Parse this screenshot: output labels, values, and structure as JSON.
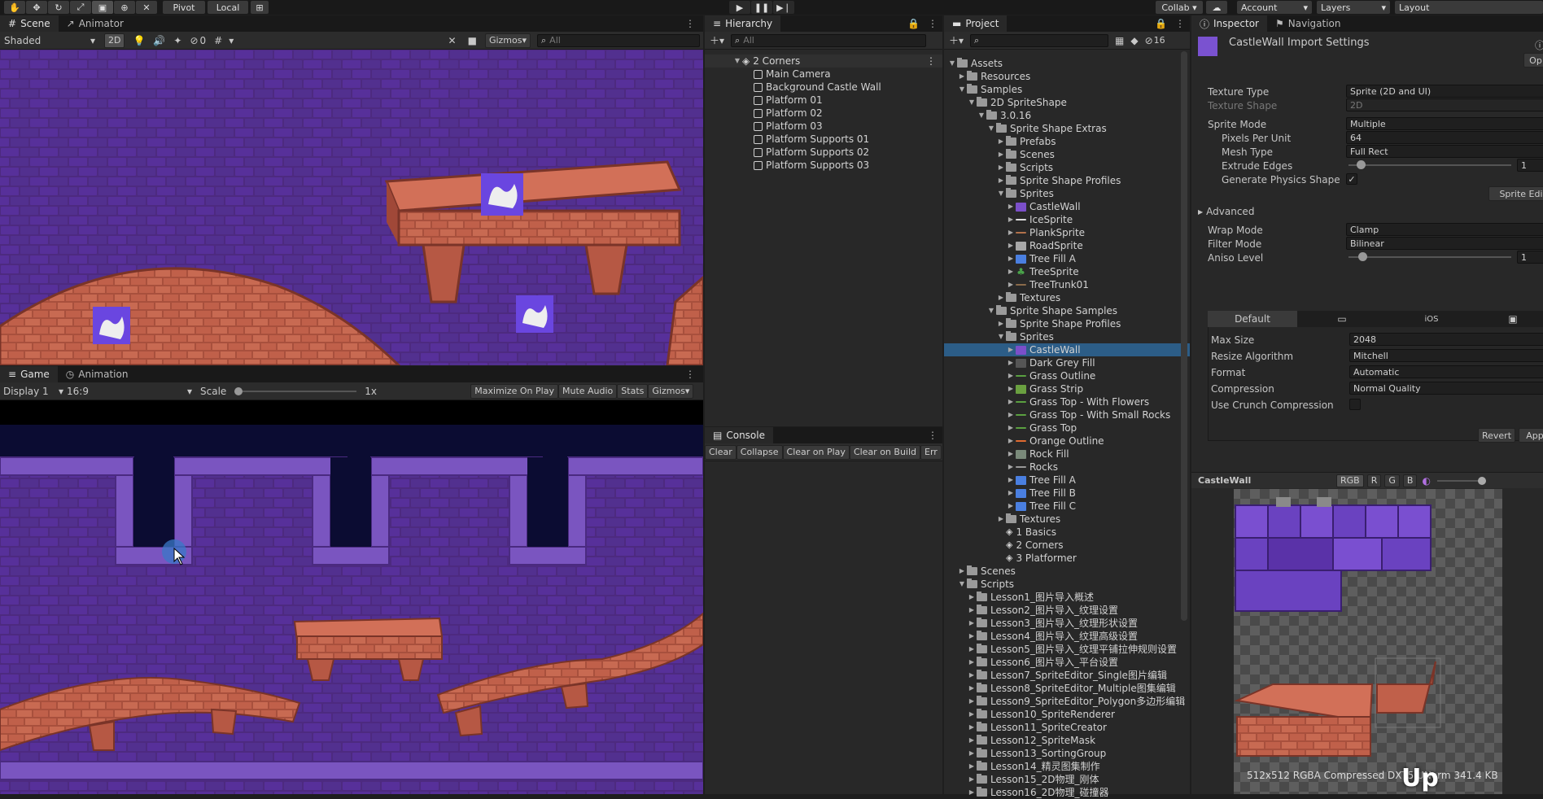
{
  "toolbar": {
    "pivot": "Pivot",
    "local": "Local",
    "collab": "Collab ▾",
    "account": "Account",
    "layers": "Layers",
    "layout": "Layout"
  },
  "scene": {
    "tab_scene": "Scene",
    "tab_animator": "Animator",
    "shading": "Shaded",
    "mode_2d": "2D",
    "gizmos": "Gizmos",
    "search_placeholder": "All",
    "fx_count": "0"
  },
  "game": {
    "tab_game": "Game",
    "tab_animation": "Animation",
    "display": "Display 1",
    "aspect": "16:9",
    "scale_label": "Scale",
    "scale_value": "1x",
    "maximize": "Maximize On Play",
    "mute": "Mute Audio",
    "stats": "Stats",
    "gizmos": "Gizmos"
  },
  "hierarchy": {
    "title": "Hierarchy",
    "search_placeholder": "All",
    "root": "2 Corners",
    "items": [
      "Main Camera",
      "Background Castle Wall",
      "Platform 01",
      "Platform 02",
      "Platform 03",
      "Platform Supports 01",
      "Platform Supports 02",
      "Platform Supports 03"
    ]
  },
  "console": {
    "title": "Console",
    "buttons": [
      "Clear",
      "Collapse",
      "Clear on Play",
      "Clear on Build",
      "Err"
    ]
  },
  "project": {
    "title": "Project",
    "hidden_count": "16",
    "rows": [
      {
        "label": "Assets",
        "indent": 0,
        "type": "folder",
        "open": true
      },
      {
        "label": "Resources",
        "indent": 1,
        "type": "folder",
        "open": false
      },
      {
        "label": "Samples",
        "indent": 1,
        "type": "folder",
        "open": true
      },
      {
        "label": "2D SpriteShape",
        "indent": 2,
        "type": "folder",
        "open": true
      },
      {
        "label": "3.0.16",
        "indent": 3,
        "type": "folder",
        "open": true
      },
      {
        "label": "Sprite Shape Extras",
        "indent": 4,
        "type": "folder",
        "open": true
      },
      {
        "label": "Prefabs",
        "indent": 5,
        "type": "folder",
        "open": false
      },
      {
        "label": "Scenes",
        "indent": 5,
        "type": "folder",
        "open": false
      },
      {
        "label": "Scripts",
        "indent": 5,
        "type": "folder",
        "open": false
      },
      {
        "label": "Sprite Shape Profiles",
        "indent": 5,
        "type": "folder",
        "open": false
      },
      {
        "label": "Sprites",
        "indent": 5,
        "type": "folder",
        "open": true
      },
      {
        "label": "CastleWall",
        "indent": 6,
        "type": "sprite",
        "color": "#7b4fc9",
        "open": false
      },
      {
        "label": "IceSprite",
        "indent": 6,
        "type": "line",
        "color": "#dddddd",
        "open": false
      },
      {
        "label": "PlankSprite",
        "indent": 6,
        "type": "line",
        "color": "#b3724a",
        "open": false
      },
      {
        "label": "RoadSprite",
        "indent": 6,
        "type": "sprite",
        "color": "#a8a8a8",
        "open": false
      },
      {
        "label": "Tree Fill A",
        "indent": 6,
        "type": "sprite",
        "color": "#4a7fe0",
        "open": false
      },
      {
        "label": "TreeSprite",
        "indent": 6,
        "type": "tree",
        "color": "#4aa34a",
        "open": false
      },
      {
        "label": "TreeTrunk01",
        "indent": 6,
        "type": "line",
        "color": "#8a6a4a",
        "open": false
      },
      {
        "label": "Textures",
        "indent": 5,
        "type": "folder",
        "open": false
      },
      {
        "label": "Sprite Shape Samples",
        "indent": 4,
        "type": "folder",
        "open": true
      },
      {
        "label": "Sprite Shape Profiles",
        "indent": 5,
        "type": "folder",
        "open": false
      },
      {
        "label": "Sprites",
        "indent": 5,
        "type": "folder",
        "open": true
      },
      {
        "label": "CastleWall",
        "indent": 6,
        "type": "sprite",
        "color": "#7b4fc9",
        "selected": true,
        "open": false
      },
      {
        "label": "Dark Grey Fill",
        "indent": 6,
        "type": "sprite",
        "color": "#555555",
        "open": false
      },
      {
        "label": "Grass Outline",
        "indent": 6,
        "type": "line",
        "color": "#5aa040",
        "open": false
      },
      {
        "label": "Grass Strip",
        "indent": 6,
        "type": "sprite",
        "color": "#6aa040",
        "open": false
      },
      {
        "label": "Grass Top - With Flowers",
        "indent": 6,
        "type": "line",
        "color": "#5aa040",
        "open": false
      },
      {
        "label": "Grass Top - With Small Rocks",
        "indent": 6,
        "type": "line",
        "color": "#5aa040",
        "open": false
      },
      {
        "label": "Grass Top",
        "indent": 6,
        "type": "line",
        "color": "#5aa040",
        "open": false
      },
      {
        "label": "Orange Outline",
        "indent": 6,
        "type": "line",
        "color": "#e06a30",
        "open": false
      },
      {
        "label": "Rock Fill",
        "indent": 6,
        "type": "sprite",
        "color": "#7a8a7a",
        "open": false
      },
      {
        "label": "Rocks",
        "indent": 6,
        "type": "line",
        "color": "#999999",
        "open": false
      },
      {
        "label": "Tree Fill A",
        "indent": 6,
        "type": "sprite",
        "color": "#4a7fe0",
        "open": false
      },
      {
        "label": "Tree Fill B",
        "indent": 6,
        "type": "sprite",
        "color": "#4a7fe0",
        "open": false
      },
      {
        "label": "Tree Fill C",
        "indent": 6,
        "type": "sprite",
        "color": "#4a7fe0",
        "open": false
      },
      {
        "label": "Textures",
        "indent": 5,
        "type": "folder",
        "open": false
      },
      {
        "label": "1 Basics",
        "indent": 5,
        "type": "scene",
        "open": false
      },
      {
        "label": "2 Corners",
        "indent": 5,
        "type": "scene",
        "open": false
      },
      {
        "label": "3 Platformer",
        "indent": 5,
        "type": "scene",
        "open": false
      },
      {
        "label": "Scenes",
        "indent": 1,
        "type": "folder",
        "open": false
      },
      {
        "label": "Scripts",
        "indent": 1,
        "type": "folder",
        "open": true
      },
      {
        "label": "Lesson1_图片导入概述",
        "indent": 2,
        "type": "folder",
        "open": false
      },
      {
        "label": "Lesson2_图片导入_纹理设置",
        "indent": 2,
        "type": "folder",
        "open": false
      },
      {
        "label": "Lesson3_图片导入_纹理形状设置",
        "indent": 2,
        "type": "folder",
        "open": false
      },
      {
        "label": "Lesson4_图片导入_纹理高级设置",
        "indent": 2,
        "type": "folder",
        "open": false
      },
      {
        "label": "Lesson5_图片导入_纹理平铺拉伸规则设置",
        "indent": 2,
        "type": "folder",
        "open": false
      },
      {
        "label": "Lesson6_图片导入_平台设置",
        "indent": 2,
        "type": "folder",
        "open": false
      },
      {
        "label": "Lesson7_SpriteEditor_Single图片编辑",
        "indent": 2,
        "type": "folder",
        "open": false
      },
      {
        "label": "Lesson8_SpriteEditor_Multiple图集编辑",
        "indent": 2,
        "type": "folder",
        "open": false
      },
      {
        "label": "Lesson9_SpriteEditor_Polygon多边形编辑",
        "indent": 2,
        "type": "folder",
        "open": false
      },
      {
        "label": "Lesson10_SpriteRenderer",
        "indent": 2,
        "type": "folder",
        "open": false
      },
      {
        "label": "Lesson11_SpriteCreator",
        "indent": 2,
        "type": "folder",
        "open": false
      },
      {
        "label": "Lesson12_SpriteMask",
        "indent": 2,
        "type": "folder",
        "open": false
      },
      {
        "label": "Lesson13_SortingGroup",
        "indent": 2,
        "type": "folder",
        "open": false
      },
      {
        "label": "Lesson14_精灵图集制作",
        "indent": 2,
        "type": "folder",
        "open": false
      },
      {
        "label": "Lesson15_2D物理_刚体",
        "indent": 2,
        "type": "folder",
        "open": false
      },
      {
        "label": "Lesson16_2D物理_碰撞器",
        "indent": 2,
        "type": "folder",
        "open": false
      }
    ]
  },
  "inspector": {
    "tab_inspector": "Inspector",
    "tab_navigation": "Navigation",
    "title": "CastleWall Import Settings",
    "open_btn": "Op",
    "texture_type_label": "Texture Type",
    "texture_type": "Sprite (2D and UI)",
    "texture_shape_label": "Texture Shape",
    "texture_shape": "2D",
    "sprite_mode_label": "Sprite Mode",
    "sprite_mode": "Multiple",
    "ppu_label": "Pixels Per Unit",
    "ppu": "64",
    "mesh_type_label": "Mesh Type",
    "mesh_type": "Full Rect",
    "extrude_label": "Extrude Edges",
    "extrude": "1",
    "extrude_level": 0.05,
    "physics_label": "Generate Physics Shape",
    "physics_checked": "✓",
    "sprite_editor_btn": "Sprite Edi",
    "advanced_label": "Advanced",
    "wrap_label": "Wrap Mode",
    "wrap": "Clamp",
    "filter_label": "Filter Mode",
    "filter": "Bilinear",
    "aniso_label": "Aniso Level",
    "aniso": "1",
    "aniso_level": 0.06,
    "platform_default": "Default",
    "platform_ios": "iOS",
    "max_size_label": "Max Size",
    "max_size": "2048",
    "resize_label": "Resize Algorithm",
    "resize": "Mitchell",
    "format_label": "Format",
    "format": "Automatic",
    "compression_label": "Compression",
    "compression": "Normal Quality",
    "crunch_label": "Use Crunch Compression",
    "revert": "Revert",
    "apply": "App",
    "preview_title": "CastleWall",
    "ch_rgb": "RGB",
    "ch_r": "R",
    "ch_g": "G",
    "ch_b": "B",
    "preview_info": "512x512  RGBA Compressed DXT5 UNorm  341.4 KB"
  },
  "overlay_text": "Up",
  "colors": {
    "selection": "#2c5d87",
    "wall_purple": "#4d2a80",
    "brick_red": "#c0604a",
    "accent_blue": "#3a78c8"
  }
}
